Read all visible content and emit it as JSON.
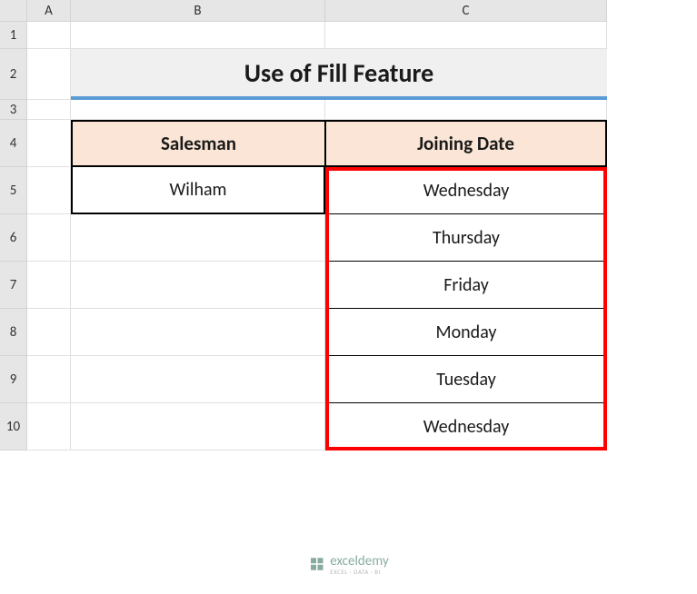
{
  "columns": [
    "A",
    "B",
    "C"
  ],
  "rows": [
    "1",
    "2",
    "3",
    "4",
    "5",
    "6",
    "7",
    "8",
    "9",
    "10"
  ],
  "title": "Use of Fill Feature",
  "table": {
    "headers": {
      "col1": "Salesman",
      "col2": "Joining Date"
    },
    "salesman": "Wilham",
    "dates": [
      "Wednesday",
      "Thursday",
      "Friday",
      "Monday",
      "Tuesday",
      "Wednesday"
    ]
  },
  "watermark": {
    "name": "exceldemy",
    "tagline": "EXCEL · DATA · BI"
  }
}
